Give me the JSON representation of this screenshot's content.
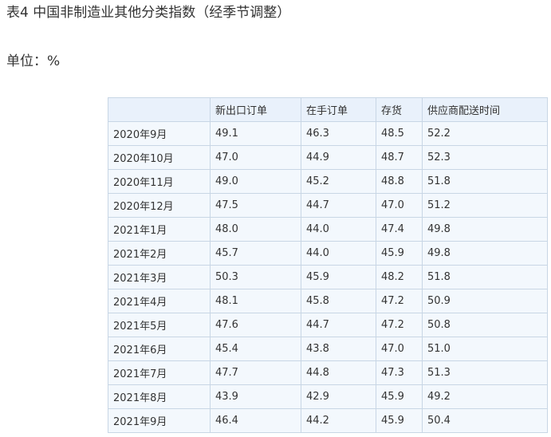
{
  "title": "表4 中国非制造业其他分类指数（经季节调整）",
  "unit": "单位：%",
  "table": {
    "headers": [
      "",
      "新出口订单",
      "在手订单",
      "存货",
      "供应商配送时间"
    ],
    "rows": [
      [
        "2020年9月",
        "49.1",
        "46.3",
        "48.5",
        "52.2"
      ],
      [
        "2020年10月",
        "47.0",
        "44.9",
        "48.7",
        "52.3"
      ],
      [
        "2020年11月",
        "49.0",
        "45.2",
        "48.8",
        "51.8"
      ],
      [
        "2020年12月",
        "47.5",
        "44.7",
        "47.0",
        "51.2"
      ],
      [
        "2021年1月",
        "48.0",
        "44.0",
        "47.4",
        "49.8"
      ],
      [
        "2021年2月",
        "45.7",
        "44.0",
        "45.9",
        "49.8"
      ],
      [
        "2021年3月",
        "50.3",
        "45.9",
        "48.2",
        "51.8"
      ],
      [
        "2021年4月",
        "48.1",
        "45.8",
        "47.2",
        "50.9"
      ],
      [
        "2021年5月",
        "47.6",
        "44.7",
        "47.2",
        "50.8"
      ],
      [
        "2021年6月",
        "45.4",
        "43.8",
        "47.0",
        "51.0"
      ],
      [
        "2021年7月",
        "47.7",
        "44.8",
        "47.3",
        "51.3"
      ],
      [
        "2021年8月",
        "43.9",
        "42.9",
        "45.9",
        "49.2"
      ],
      [
        "2021年9月",
        "46.4",
        "44.2",
        "45.9",
        "50.4"
      ]
    ]
  },
  "colors": {
    "header_bg": "#e9f1fb",
    "cell_bg": "#f3f8fd",
    "border": "#c8d6e5",
    "text": "#333333"
  }
}
